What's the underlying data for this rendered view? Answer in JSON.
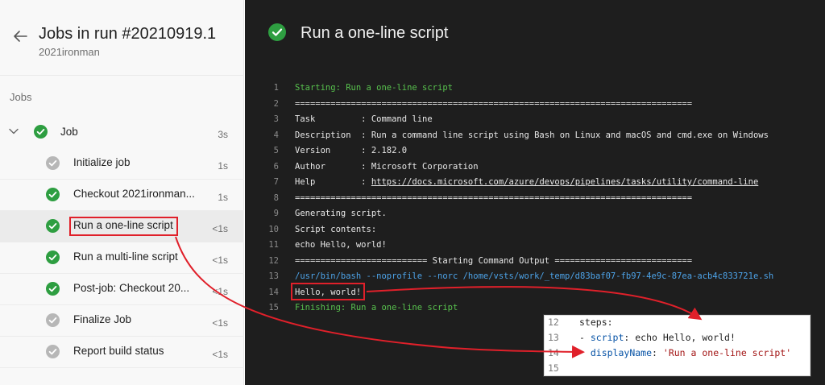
{
  "header": {
    "title": "Jobs in run #20210919.1",
    "subtitle": "2021ironman"
  },
  "sidebar": {
    "section_label": "Jobs",
    "job": {
      "label": "Job",
      "duration": "3s",
      "status": "success"
    },
    "steps": [
      {
        "label": "Initialize job",
        "duration": "1s",
        "status": "skipped"
      },
      {
        "label": "Checkout 2021ironman...",
        "duration": "1s",
        "status": "success"
      },
      {
        "label": "Run a one-line script",
        "duration": "<1s",
        "status": "success",
        "selected": true
      },
      {
        "label": "Run a multi-line script",
        "duration": "<1s",
        "status": "success"
      },
      {
        "label": "Post-job: Checkout 20...",
        "duration": "<1s",
        "status": "success"
      },
      {
        "label": "Finalize Job",
        "duration": "<1s",
        "status": "skipped"
      },
      {
        "label": "Report build status",
        "duration": "<1s",
        "status": "skipped"
      }
    ]
  },
  "log": {
    "title": "Run a one-line script",
    "lines": [
      {
        "n": "1",
        "text": "Starting: Run a one-line script",
        "style": "green"
      },
      {
        "n": "2",
        "text": "==============================================================================",
        "style": ""
      },
      {
        "n": "3",
        "text": "Task         : Command line",
        "style": ""
      },
      {
        "n": "4",
        "text": "Description  : Run a command line script using Bash on Linux and macOS and cmd.exe on Windows",
        "style": ""
      },
      {
        "n": "5",
        "text": "Version      : 2.182.0",
        "style": ""
      },
      {
        "n": "6",
        "text": "Author       : Microsoft Corporation",
        "style": ""
      },
      {
        "n": "7",
        "text": "Help         : ",
        "link": "https://docs.microsoft.com/azure/devops/pipelines/tasks/utility/command-line",
        "style": ""
      },
      {
        "n": "8",
        "text": "==============================================================================",
        "style": ""
      },
      {
        "n": "9",
        "text": "Generating script.",
        "style": ""
      },
      {
        "n": "10",
        "text": "Script contents:",
        "style": ""
      },
      {
        "n": "11",
        "text": "echo Hello, world!",
        "style": ""
      },
      {
        "n": "12",
        "text": "========================== Starting Command Output ===========================",
        "style": ""
      },
      {
        "n": "13",
        "text": "/usr/bin/bash --noprofile --norc /home/vsts/work/_temp/d83baf07-fb97-4e9c-87ea-acb4c833721e.sh",
        "style": "blue"
      },
      {
        "n": "14",
        "text": "Hello, world!",
        "style": ""
      },
      {
        "n": "15",
        "text": "Finishing: Run a one-line script",
        "style": "green"
      }
    ]
  },
  "yaml": {
    "lines": [
      {
        "n": "12",
        "parts": [
          {
            "t": "steps:",
            "c": ""
          }
        ]
      },
      {
        "n": "13",
        "parts": [
          {
            "t": "- ",
            "c": ""
          },
          {
            "t": "script",
            "c": "key"
          },
          {
            "t": ": echo Hello, world!",
            "c": ""
          }
        ]
      },
      {
        "n": "14",
        "parts": [
          {
            "t": "  ",
            "c": ""
          },
          {
            "t": "displayName",
            "c": "key"
          },
          {
            "t": ": ",
            "c": ""
          },
          {
            "t": "'Run a one-line script'",
            "c": "str"
          }
        ]
      },
      {
        "n": "15",
        "parts": [
          {
            "t": "",
            "c": ""
          }
        ]
      }
    ]
  },
  "colors": {
    "success": "#2e9e41",
    "skipped": "#b7b7b7",
    "highlight": "#e0202a",
    "log_bg": "#1e1e1e"
  }
}
